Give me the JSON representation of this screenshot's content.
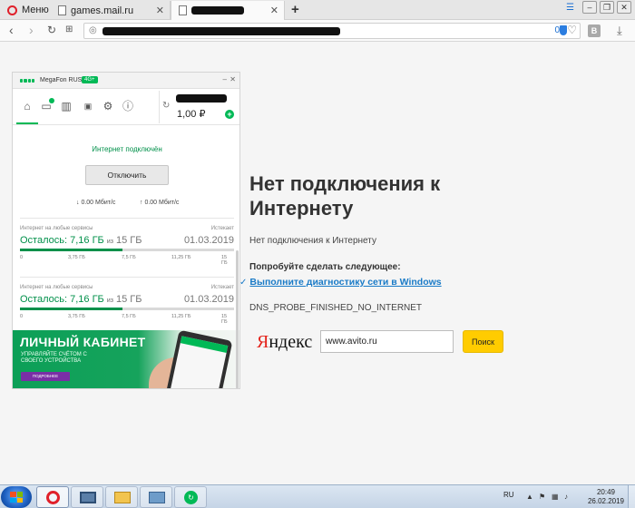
{
  "browser": {
    "menu_label": "Меню",
    "tabs": [
      {
        "label": "games.mail.ru"
      },
      {
        "label": ""
      }
    ],
    "new_tab_label": "+",
    "address_counter": "0",
    "vk_label": "В"
  },
  "widget": {
    "operator": "MegaFon RUS",
    "network_badge": "4G+",
    "balance": "1,00 ₽",
    "connection_status": "Интернет подключён",
    "disconnect_label": "Отключить",
    "download_speed": "↓ 0.00 Мбит/с",
    "upload_speed": "↑ 0.00 Мбит/с",
    "quotas": [
      {
        "label": "Интернет на любые сервисы",
        "expires_label": "Истекает",
        "remaining_prefix": "Осталось:",
        "remaining": "7,16 ГБ",
        "of_word": "из",
        "total": "15 ГБ",
        "date": "01.03.2019",
        "remaining_fraction": 0.48,
        "ticks": [
          "0",
          "3,75 ГБ",
          "7,5 ГБ",
          "11,25 ГБ",
          "15 ГБ"
        ]
      },
      {
        "label": "Интернет на любые сервисы",
        "expires_label": "Истекает",
        "remaining_prefix": "Осталось:",
        "remaining": "7,16 ГБ",
        "of_word": "из",
        "total": "15 ГБ",
        "date": "01.03.2019",
        "remaining_fraction": 0.48,
        "ticks": [
          "0",
          "3,75 ГБ",
          "7,5 ГБ",
          "11,25 ГБ",
          "15 ГБ"
        ]
      }
    ],
    "banner": {
      "title": "ЛИЧНЫЙ КАБИНЕТ",
      "subtitle": "УПРАВЛЯЙТЕ СЧЁТОМ С СВОЕГО УСТРОЙСТВА",
      "button": "ПОДРОБНЕЕ"
    },
    "accent_color": "#00b956"
  },
  "error_page": {
    "title": "Нет подключения к Интернету",
    "subtitle": "Нет подключения к Интернету",
    "try_heading": "Попробуйте сделать следующее:",
    "diagnostic_link": "Выполните диагностику сети в Windows",
    "error_code": "DNS_PROBE_FINISHED_NO_INTERNET",
    "link_color": "#1a7bc7"
  },
  "yandex": {
    "logo_first": "Я",
    "logo_rest": "ндекс",
    "search_value": "www.avito.ru",
    "search_button": "Поиск",
    "button_color": "#ffcc00"
  },
  "taskbar": {
    "language": "RU",
    "time": "20:49",
    "date": "26.02.2019"
  }
}
